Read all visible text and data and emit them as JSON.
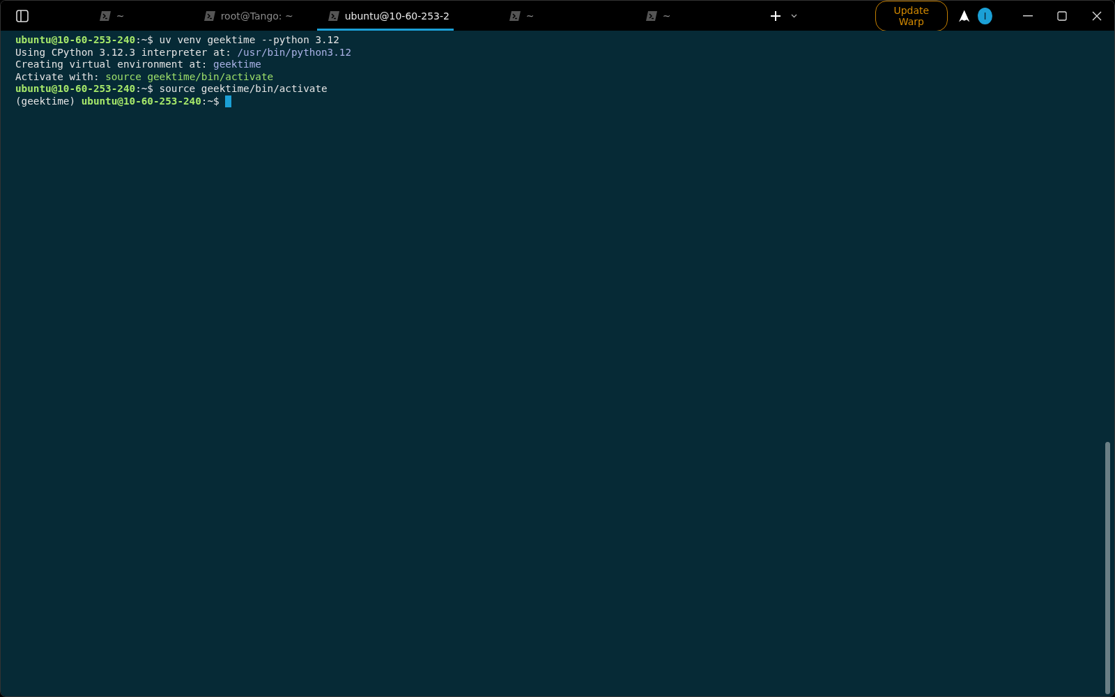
{
  "tabs": [
    {
      "title": "~",
      "selected": false
    },
    {
      "title": "root@Tango: ~",
      "selected": false
    },
    {
      "title": "ubuntu@10-60-253-2",
      "selected": true
    },
    {
      "title": "~",
      "selected": false
    },
    {
      "title": "~",
      "selected": false
    }
  ],
  "update_button": "Update Warp",
  "avatar_letter": "I",
  "terminal": {
    "lines": [
      [
        {
          "kind": "prompt",
          "text": "ubuntu@10-60-253-240"
        },
        {
          "kind": "plain",
          "text": ":~$ uv venv geektime --python 3.12"
        }
      ],
      [
        {
          "kind": "plain",
          "text": "Using CPython 3.12.3 interpreter at: "
        },
        {
          "kind": "path",
          "text": "/usr/bin/python3.12"
        }
      ],
      [
        {
          "kind": "plain",
          "text": "Creating virtual environment at: "
        },
        {
          "kind": "path",
          "text": "geektime"
        }
      ],
      [
        {
          "kind": "plain",
          "text": "Activate with: "
        },
        {
          "kind": "command",
          "text": "source geektime/bin/activate"
        }
      ],
      [
        {
          "kind": "prompt",
          "text": "ubuntu@10-60-253-240"
        },
        {
          "kind": "plain",
          "text": ":~$ source geektime/bin/activate"
        }
      ],
      [
        {
          "kind": "plain",
          "text": "(geektime) "
        },
        {
          "kind": "prompt",
          "text": "ubuntu@10-60-253-240"
        },
        {
          "kind": "plain",
          "text": ":~$ "
        }
      ]
    ]
  }
}
